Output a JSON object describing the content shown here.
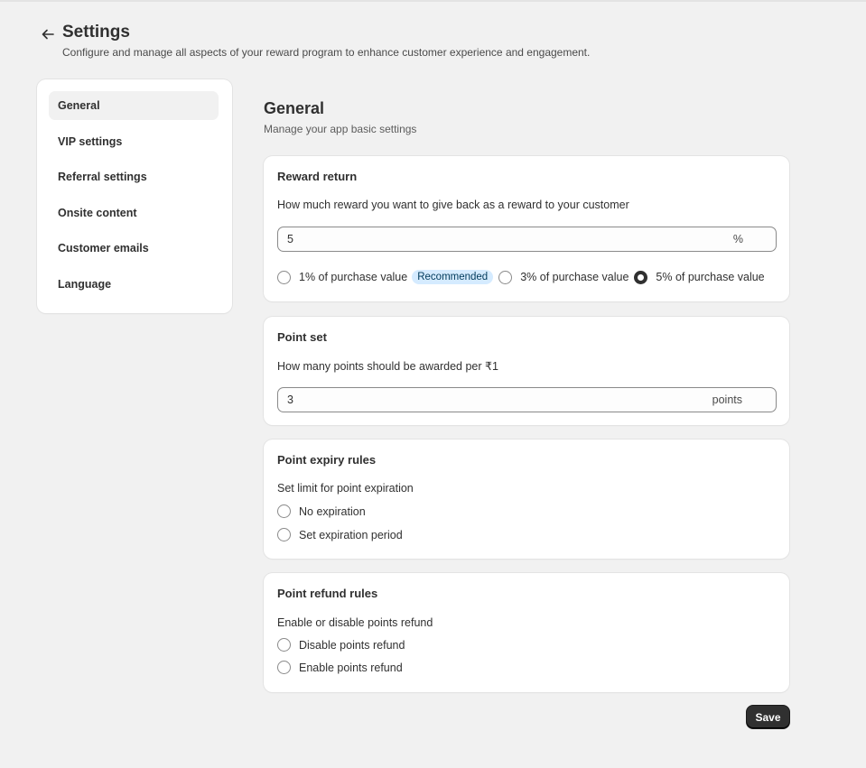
{
  "header": {
    "title": "Settings",
    "subtitle": "Configure and manage all aspects of your reward program to enhance customer experience and engagement."
  },
  "sidebar": {
    "items": [
      {
        "label": "General",
        "active": true
      },
      {
        "label": "VIP settings"
      },
      {
        "label": "Referral settings"
      },
      {
        "label": "Onsite content"
      },
      {
        "label": "Customer emails"
      },
      {
        "label": "Language"
      }
    ]
  },
  "main": {
    "title": "General",
    "subtitle": "Manage your app basic settings"
  },
  "reward_return": {
    "title": "Reward return",
    "description": "How much reward you want to give back as a reward to your customer",
    "value": "5",
    "suffix": "%",
    "options": [
      {
        "label": "1% of purchase value",
        "badge": "Recommended",
        "checked": false
      },
      {
        "label": "3% of purchase value",
        "checked": false
      },
      {
        "label": "5% of purchase value",
        "checked": true
      }
    ]
  },
  "point_set": {
    "title": "Point set",
    "description": "How many points should be awarded per ₹1",
    "value": "3",
    "suffix": "points"
  },
  "point_expiry": {
    "title": "Point expiry rules",
    "description": "Set limit for point expiration",
    "options": [
      {
        "label": "No expiration",
        "checked": false
      },
      {
        "label": "Set expiration period",
        "checked": false
      }
    ]
  },
  "point_refund": {
    "title": "Point refund rules",
    "description": "Enable or disable points refund",
    "options": [
      {
        "label": "Disable points refund",
        "checked": false
      },
      {
        "label": "Enable points refund",
        "checked": false
      }
    ]
  },
  "actions": {
    "save_label": "Save"
  },
  "colors": {
    "background": "#f1f1f1",
    "card": "#ffffff",
    "primary_button": "#303030",
    "badge_bg": "#d5ebff"
  }
}
